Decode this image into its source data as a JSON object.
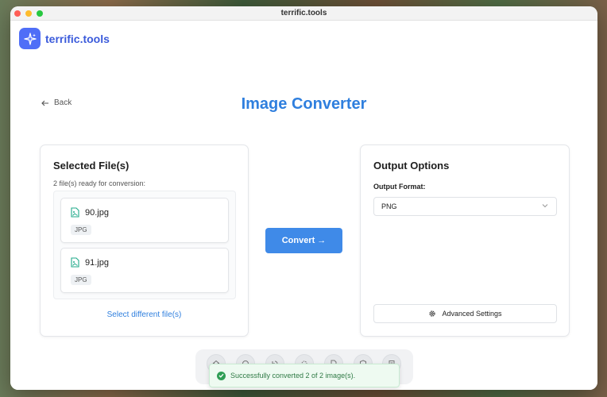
{
  "window": {
    "title": "terrific.tools"
  },
  "brand": {
    "name": "terrific.tools",
    "logo_icon": "sparkles-icon"
  },
  "nav": {
    "back_label": "Back"
  },
  "page": {
    "title": "Image Converter"
  },
  "selected_files": {
    "heading": "Selected File(s)",
    "status": "2 file(s) ready for conversion:",
    "files": [
      {
        "name": "90.jpg",
        "type": "JPG"
      },
      {
        "name": "91.jpg",
        "type": "JPG"
      }
    ],
    "select_different_label": "Select different file(s)"
  },
  "convert": {
    "label": "Convert →"
  },
  "output": {
    "heading": "Output Options",
    "format_label": "Output Format:",
    "format_value": "PNG",
    "advanced_label": "Advanced Settings"
  },
  "toast": {
    "message": "Successfully converted 2 of 2 image(s)."
  },
  "colors": {
    "accent": "#2f7fde",
    "button": "#3f8ae8",
    "brand": "#4f6ef7",
    "success": "#2f9e55"
  },
  "dock": {
    "icons": [
      "home-icon",
      "chat-icon",
      "history-icon",
      "settings-icon",
      "document-icon",
      "shield-icon",
      "notes-icon"
    ]
  }
}
